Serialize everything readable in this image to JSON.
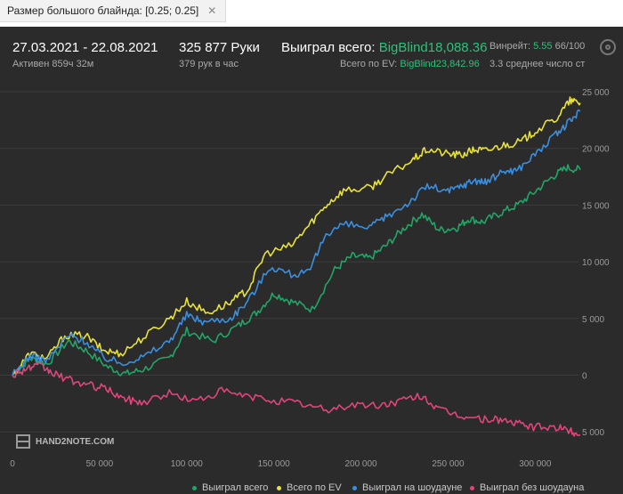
{
  "filter": {
    "label": "Размер большого блайнда: [0.25; 0.25]",
    "close": "✕"
  },
  "header": {
    "date_range": "27.03.2021 - 22.08.2021",
    "active": "Активен 859ч 32м",
    "hands": "325 877 Руки",
    "hands_per_hour": "379 рук в час",
    "won_total_label": "Выиграл всего:",
    "won_total_value": "BigBlind18,088.36",
    "ev_label": "Всего по EV:",
    "ev_value": "BigBlind23,842.96",
    "winrate_label": "Винрейт:",
    "winrate_value": "5.55",
    "winrate_tail": "66/100",
    "avg_line": "3.3 среднее число ст"
  },
  "logo": {
    "text": "HAND2NOTE.COM"
  },
  "settings_icon": "gear-icon",
  "colors": {
    "won": "#22a566",
    "ev": "#e8e23a",
    "showdown": "#3b8fe0",
    "no_showdown": "#e0457c",
    "background": "#2b2b2b"
  },
  "chart_data": {
    "type": "line",
    "xlim": [
      0,
      325877
    ],
    "ylim": [
      -5500,
      25000
    ],
    "x_ticks": [
      0,
      50000,
      100000,
      150000,
      200000,
      250000,
      300000
    ],
    "x_tick_labels": [
      "0",
      "50 000",
      "100 000",
      "150 000",
      "200 000",
      "250 000",
      "300 000"
    ],
    "y_ticks": [
      25000,
      20000,
      15000,
      10000,
      5000,
      0,
      -5000
    ],
    "y_tick_labels": [
      "25 000",
      "20 000",
      "15 000",
      "10 000",
      "5 000",
      "0",
      "5 000"
    ],
    "grid": "horizontal",
    "legend_position": "bottom-right",
    "series": [
      {
        "name": "Выиграл всего",
        "color": "#22a566",
        "points": [
          [
            0,
            0
          ],
          [
            10000,
            1500
          ],
          [
            20000,
            1000
          ],
          [
            32000,
            3000
          ],
          [
            42000,
            2200
          ],
          [
            55000,
            700
          ],
          [
            65000,
            100
          ],
          [
            75000,
            500
          ],
          [
            90000,
            1500
          ],
          [
            100000,
            3900
          ],
          [
            115000,
            3000
          ],
          [
            130000,
            4400
          ],
          [
            140000,
            5500
          ],
          [
            150000,
            7200
          ],
          [
            160000,
            6500
          ],
          [
            172000,
            5800
          ],
          [
            185000,
            9300
          ],
          [
            195000,
            10500
          ],
          [
            205000,
            10300
          ],
          [
            215000,
            11500
          ],
          [
            225000,
            13000
          ],
          [
            235000,
            14200
          ],
          [
            245000,
            12800
          ],
          [
            255000,
            13000
          ],
          [
            262000,
            13800
          ],
          [
            270000,
            13500
          ],
          [
            280000,
            14300
          ],
          [
            290000,
            15000
          ],
          [
            300000,
            16200
          ],
          [
            310000,
            17500
          ],
          [
            318000,
            18300
          ],
          [
            325877,
            18100
          ]
        ]
      },
      {
        "name": "Всего по EV",
        "color": "#e8e23a",
        "points": [
          [
            0,
            0
          ],
          [
            10000,
            1900
          ],
          [
            20000,
            1500
          ],
          [
            30000,
            3500
          ],
          [
            42000,
            3500
          ],
          [
            52000,
            2200
          ],
          [
            62000,
            1900
          ],
          [
            75000,
            3300
          ],
          [
            90000,
            5000
          ],
          [
            100000,
            6500
          ],
          [
            112000,
            5500
          ],
          [
            125000,
            6400
          ],
          [
            135000,
            7500
          ],
          [
            145000,
            10700
          ],
          [
            160000,
            11400
          ],
          [
            170000,
            13200
          ],
          [
            180000,
            15000
          ],
          [
            190000,
            16300
          ],
          [
            205000,
            16500
          ],
          [
            215000,
            17600
          ],
          [
            230000,
            19000
          ],
          [
            238000,
            19900
          ],
          [
            250000,
            19500
          ],
          [
            258000,
            19400
          ],
          [
            265000,
            19900
          ],
          [
            272000,
            19800
          ],
          [
            282000,
            20300
          ],
          [
            292000,
            20600
          ],
          [
            300000,
            21500
          ],
          [
            312000,
            22600
          ],
          [
            320000,
            24200
          ],
          [
            325877,
            24000
          ]
        ]
      },
      {
        "name": "Выиграл на шоудауне",
        "color": "#3b8fe0",
        "points": [
          [
            0,
            0
          ],
          [
            10000,
            1700
          ],
          [
            20000,
            1300
          ],
          [
            32000,
            3500
          ],
          [
            42000,
            3000
          ],
          [
            52000,
            1600
          ],
          [
            62000,
            1100
          ],
          [
            75000,
            1600
          ],
          [
            90000,
            3000
          ],
          [
            100000,
            5300
          ],
          [
            110000,
            4700
          ],
          [
            125000,
            5000
          ],
          [
            135000,
            6500
          ],
          [
            148000,
            9600
          ],
          [
            160000,
            8900
          ],
          [
            170000,
            9000
          ],
          [
            180000,
            12500
          ],
          [
            190000,
            13300
          ],
          [
            205000,
            13000
          ],
          [
            215000,
            14000
          ],
          [
            228000,
            15300
          ],
          [
            238000,
            16700
          ],
          [
            250000,
            16200
          ],
          [
            258000,
            16700
          ],
          [
            265000,
            17200
          ],
          [
            272000,
            17000
          ],
          [
            282000,
            18000
          ],
          [
            290000,
            18100
          ],
          [
            300000,
            19500
          ],
          [
            312000,
            21200
          ],
          [
            320000,
            22400
          ],
          [
            325877,
            23300
          ]
        ]
      },
      {
        "name": "Выиграл без шоудауна",
        "color": "#e0457c",
        "points": [
          [
            0,
            0
          ],
          [
            8000,
            600
          ],
          [
            16000,
            800
          ],
          [
            24000,
            100
          ],
          [
            34000,
            -500
          ],
          [
            44000,
            -900
          ],
          [
            54000,
            -1200
          ],
          [
            64000,
            -2100
          ],
          [
            74000,
            -2400
          ],
          [
            90000,
            -1600
          ],
          [
            105000,
            -2300
          ],
          [
            120000,
            -1400
          ],
          [
            135000,
            -1900
          ],
          [
            150000,
            -2200
          ],
          [
            165000,
            -2500
          ],
          [
            180000,
            -3100
          ],
          [
            195000,
            -2600
          ],
          [
            210000,
            -2700
          ],
          [
            222000,
            -2300
          ],
          [
            235000,
            -1800
          ],
          [
            245000,
            -3100
          ],
          [
            258000,
            -3600
          ],
          [
            270000,
            -3900
          ],
          [
            280000,
            -3900
          ],
          [
            290000,
            -4300
          ],
          [
            300000,
            -4600
          ],
          [
            312000,
            -4600
          ],
          [
            320000,
            -4900
          ],
          [
            325877,
            -5300
          ]
        ]
      }
    ]
  }
}
